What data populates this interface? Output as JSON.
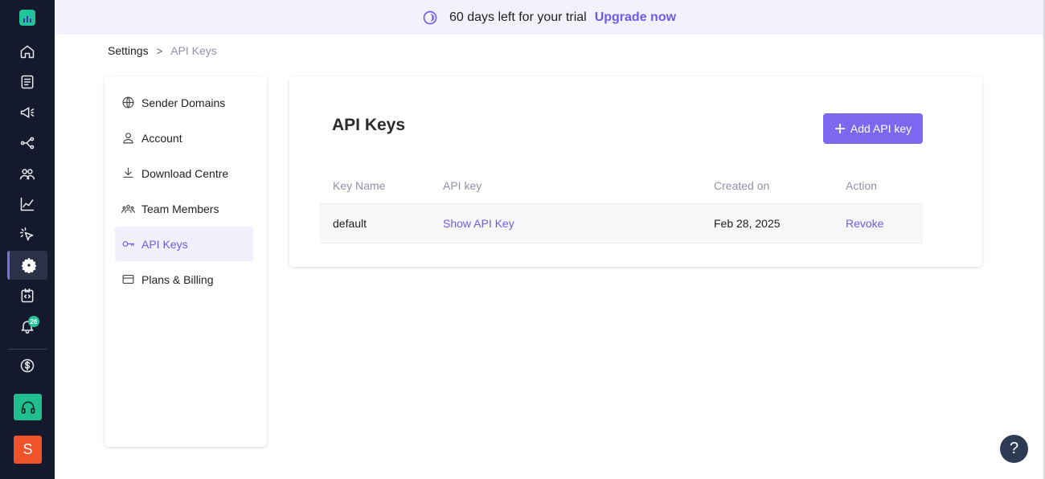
{
  "banner": {
    "trial_text": "60 days left for your trial",
    "upgrade_label": "Upgrade now"
  },
  "rail": {
    "notification_count": "26",
    "avatar_initial": "S",
    "icons": [
      "home-icon",
      "document-icon",
      "megaphone-icon",
      "workflow-icon",
      "contacts-icon",
      "analytics-icon",
      "click-icon",
      "settings-icon",
      "code-icon",
      "bell-icon",
      "dollar-icon",
      "headset-icon"
    ]
  },
  "breadcrumb": {
    "root": "Settings",
    "separator": ">",
    "current": "API Keys"
  },
  "settings_nav": {
    "items": [
      {
        "label": "Sender Domains",
        "icon": "globe-icon"
      },
      {
        "label": "Account",
        "icon": "user-icon"
      },
      {
        "label": "Download Centre",
        "icon": "download-icon"
      },
      {
        "label": "Team Members",
        "icon": "team-icon"
      },
      {
        "label": "API Keys",
        "icon": "key-icon",
        "active": true
      },
      {
        "label": "Plans & Billing",
        "icon": "credit-card-icon"
      }
    ]
  },
  "main": {
    "title": "API Keys",
    "add_button_label": "Add API key",
    "table": {
      "columns": [
        "Key Name",
        "API key",
        "Created on",
        "Action"
      ],
      "rows": [
        {
          "key_name": "default",
          "api_key": "Show API Key",
          "created_on": "Feb 28, 2025",
          "action": "Revoke"
        }
      ]
    }
  },
  "help": {
    "label": "?"
  },
  "colors": {
    "accent": "#7b68ee",
    "rail_bg": "#141a2b",
    "banner_bg": "#f3f1fb",
    "support_green": "#1fbf8f",
    "avatar_orange": "#f0532a"
  }
}
